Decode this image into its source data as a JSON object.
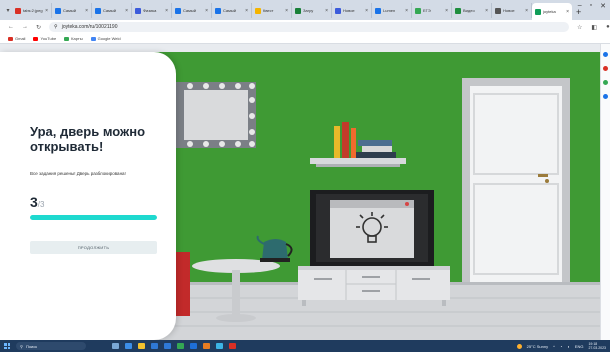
{
  "browser": {
    "tabs": [
      {
        "title": "tabs:2:jpeg",
        "color": "#d93025",
        "active": false
      },
      {
        "title": "Самый",
        "color": "#1a73e8",
        "active": false
      },
      {
        "title": "Самый",
        "color": "#1a73e8",
        "active": false
      },
      {
        "title": "Физика",
        "color": "#3b5bdb",
        "active": false
      },
      {
        "title": "Самый",
        "color": "#1a73e8",
        "active": false
      },
      {
        "title": "Самый",
        "color": "#1a73e8",
        "active": false
      },
      {
        "title": "Квест",
        "color": "#f4b400",
        "active": false
      },
      {
        "title": "Загру",
        "color": "#188038",
        "active": false
      },
      {
        "title": "Новое",
        "color": "#3b5bdb",
        "active": false
      },
      {
        "title": "Lumen",
        "color": "#1a73e8",
        "active": false
      },
      {
        "title": "ЕГЭ",
        "color": "#34a853",
        "active": false
      },
      {
        "title": "Видео",
        "color": "#1e8e3e",
        "active": false
      },
      {
        "title": "Новое",
        "color": "#555555",
        "active": false
      },
      {
        "title": "joyteka",
        "color": "#0f9d58",
        "active": true
      }
    ],
    "address": "joyteka.com/ru/10021190",
    "bookmarks": [
      {
        "label": "Gmail",
        "color": "#d93025"
      },
      {
        "label": "YouTube",
        "color": "#ff0000"
      },
      {
        "label": "Карты",
        "color": "#34a853"
      },
      {
        "label": "Google Weld",
        "color": "#4285f4"
      }
    ]
  },
  "panel": {
    "title": "Ура, дверь можно открывать!",
    "subtitle": "Все задания решены! Дверь разблокирована!",
    "count_done": "3",
    "count_total": "/3",
    "progress_fraction": 1.0,
    "button_label": "ПРОДОЛЖИТЬ"
  },
  "taskbar": {
    "search_placeholder": "Поиск",
    "weather": "25°C Sunny",
    "lang": "ENG",
    "time": "19:18",
    "date": "27.03.2023"
  },
  "colors": {
    "wall": "#3f9a34",
    "floor": "#d3d5d8",
    "accent": "#1ed9cf"
  }
}
